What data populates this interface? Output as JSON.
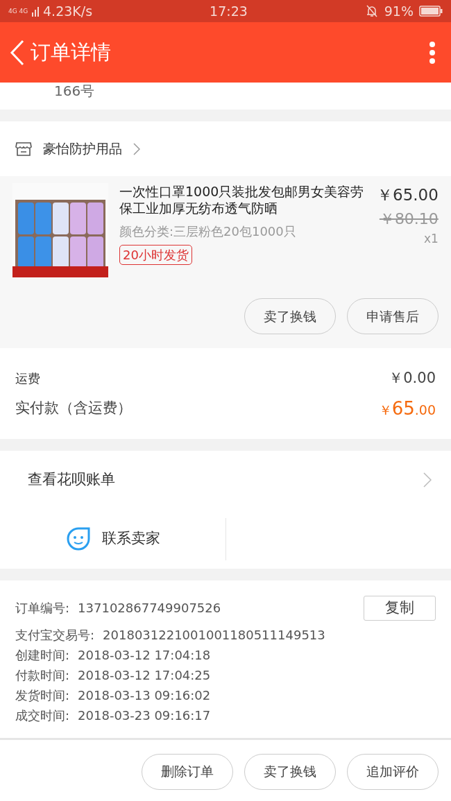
{
  "status_bar": {
    "network": "4G 4G",
    "speed": "4.23K/s",
    "time": "17:23",
    "battery": "91%"
  },
  "header": {
    "title": "订单详情"
  },
  "address_tail": "166号",
  "shop": {
    "name": "豪怡防护用品"
  },
  "product": {
    "title": "一次性口罩1000只装批发包邮男女美容劳保工业加厚无纺布透气防晒",
    "sku": "颜色分类:三层粉色20包1000只",
    "tag": "20小时发货",
    "price": "￥65.00",
    "original_price": "￥80.10",
    "quantity": "x1"
  },
  "product_buttons": [
    "卖了换钱",
    "申请售后"
  ],
  "shipping": {
    "label": "运费",
    "value": "￥0.00"
  },
  "paid": {
    "label": "实付款（含运费）",
    "currency": "￥",
    "integer": "65",
    "decimal": ".00"
  },
  "huabei": {
    "label": "查看花呗账单"
  },
  "contact": {
    "label": "联系卖家"
  },
  "order_info": [
    {
      "label": "订单编号:",
      "value": "137102867749907526",
      "copy": "复制"
    },
    {
      "label": "支付宝交易号:",
      "value": "2018031221001001180511149513"
    },
    {
      "label": "创建时间:",
      "value": "2018-03-12 17:04:18"
    },
    {
      "label": "付款时间:",
      "value": "2018-03-12 17:04:25"
    },
    {
      "label": "发货时间:",
      "value": "2018-03-13 09:16:02"
    },
    {
      "label": "成交时间:",
      "value": "2018-03-23 09:16:17"
    }
  ],
  "bottom_buttons": [
    "删除订单",
    "卖了换钱",
    "追加评价"
  ]
}
